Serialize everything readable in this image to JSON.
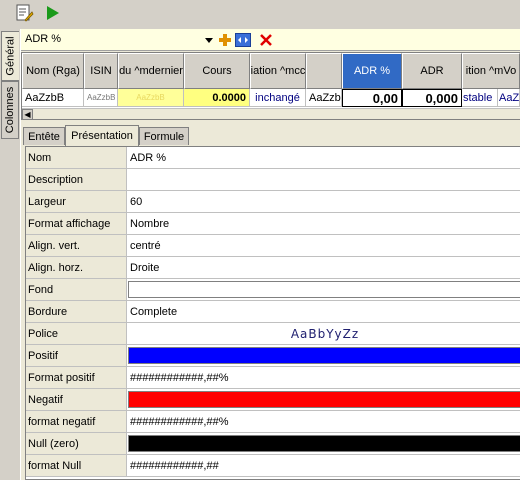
{
  "toolbar": {
    "edit_icon": "edit-document-icon",
    "run_icon": "play-icon"
  },
  "vertical_tabs": [
    "Général",
    "Colonnes"
  ],
  "column_bar": {
    "name": "ADR %",
    "icons": [
      "dropdown-arrow-icon",
      "add-icon",
      "move-icon",
      "delete-icon"
    ]
  },
  "grid": {
    "headers": [
      "Nom (Rga)",
      "ISIN",
      "du ^mdernier",
      "Cours",
      "iation ^mcc",
      "",
      "ADR %",
      "ADR",
      "ition ^mVo"
    ],
    "row": [
      "AaZzbB",
      "AaZzbB",
      "AaZzbB",
      "0.0000",
      "inchangé",
      "AaZzb",
      "0,00",
      "0,000",
      "stable",
      "AaZ"
    ]
  },
  "tabs": [
    "Entête",
    "Présentation",
    "Formule"
  ],
  "properties": [
    {
      "name": "Nom",
      "value": "ADR %"
    },
    {
      "name": "Description",
      "value": ""
    },
    {
      "name": "Largeur",
      "value": "60"
    },
    {
      "name": "Format affichage",
      "value": "Nombre"
    },
    {
      "name": "Align. vert.",
      "value": "centré"
    },
    {
      "name": "Align. horz.",
      "value": "Droite"
    },
    {
      "name": "Fond",
      "value": ""
    },
    {
      "name": "Bordure",
      "value": "Complete"
    },
    {
      "name": "Police",
      "value": "AaBbYyZz"
    },
    {
      "name": "Positif",
      "value": ""
    },
    {
      "name": "Format positif",
      "value": "############,##%"
    },
    {
      "name": "Negatif",
      "value": ""
    },
    {
      "name": "format negatif",
      "value": "############,##%"
    },
    {
      "name": "Null (zero)",
      "value": ""
    },
    {
      "name": "format Null",
      "value": "############,##"
    }
  ],
  "colors": {
    "positif": "#0000ff",
    "negatif": "#ff0000",
    "null": "#000000",
    "fond": "#ffffff",
    "selected_header": "#316ac5",
    "cours_cell": "#ffff99"
  }
}
